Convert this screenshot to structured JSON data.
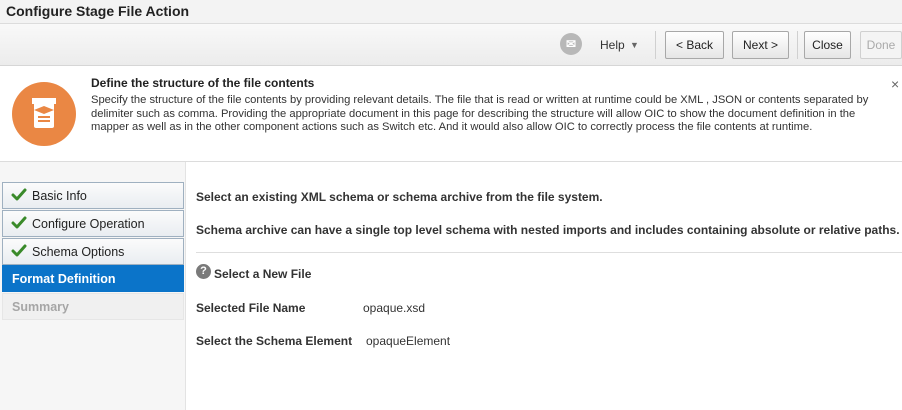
{
  "window": {
    "title": "Configure Stage File Action"
  },
  "toolbar": {
    "help_icon": "oracle-help-icon",
    "help_label": "Help",
    "back_label": "< Back",
    "next_label": "Next >",
    "close_label": "Close",
    "done_label": "Done"
  },
  "info": {
    "icon": "document-definition-icon",
    "title": "Define the structure of the file contents",
    "text": "Specify the structure of the file contents by providing relevant details. The file that is read or written at runtime could be XML , JSON or contents separated by delimiter such as comma. Providing the appropriate document in this page for describing the structure will allow OIC to show the document definition in the mapper as well as in the other component actions such as Switch etc. And it would also allow OIC to correctly process the file contents at runtime.",
    "close_glyph": "×"
  },
  "steps": [
    {
      "label": "Basic Info",
      "state": "completed"
    },
    {
      "label": "Configure Operation",
      "state": "completed"
    },
    {
      "label": "Schema Options",
      "state": "completed"
    },
    {
      "label": "Format Definition",
      "state": "active"
    },
    {
      "label": "Summary",
      "state": "disabled"
    }
  ],
  "main": {
    "intro": "Select an existing XML schema or schema archive from the file system.",
    "archive_note": "Schema archive can have a single top level schema with nested imports and includes containing absolute or relative paths.",
    "select_new_file": "Select a New File",
    "help_glyph": "?",
    "selected_file_label": "Selected File Name",
    "selected_file_value": "opaque.xsd",
    "schema_element_label": "Select the Schema Element",
    "schema_element_value": "opaqueElement"
  },
  "colors": {
    "accent": "#0b74c9",
    "info_icon": "#ea8744",
    "check": "#3a8a2a"
  }
}
